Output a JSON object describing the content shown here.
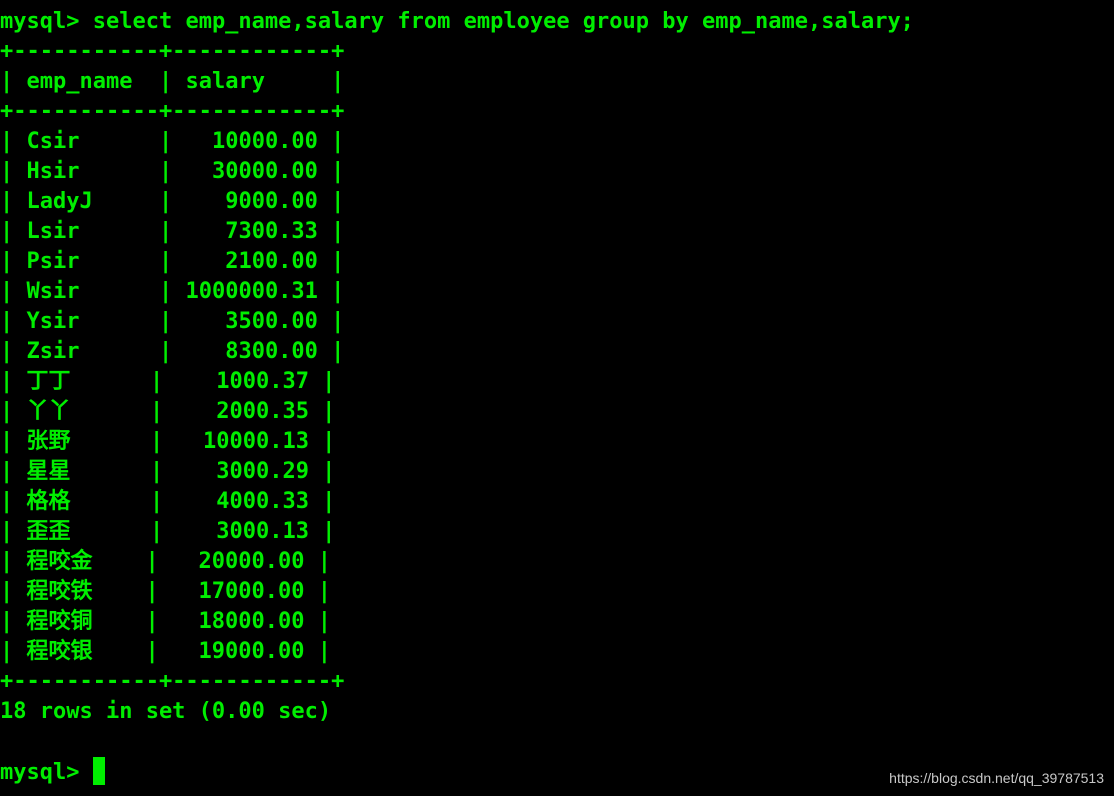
{
  "prompt": "mysql>",
  "command": "select emp_name,salary from employee group by emp_name,salary;",
  "table": {
    "border_line": "+-----------+------------+",
    "columns": [
      "emp_name",
      "salary"
    ],
    "rows": [
      [
        "Csir",
        "10000.00"
      ],
      [
        "Hsir",
        "30000.00"
      ],
      [
        "LadyJ",
        "9000.00"
      ],
      [
        "Lsir",
        "7300.33"
      ],
      [
        "Psir",
        "2100.00"
      ],
      [
        "Wsir",
        "1000000.31"
      ],
      [
        "Ysir",
        "3500.00"
      ],
      [
        "Zsir",
        "8300.00"
      ],
      [
        "丁丁",
        "1000.37"
      ],
      [
        "丫丫",
        "2000.35"
      ],
      [
        "张野",
        "10000.13"
      ],
      [
        "星星",
        "3000.29"
      ],
      [
        "格格",
        "4000.33"
      ],
      [
        "歪歪",
        "3000.13"
      ],
      [
        "程咬金",
        "20000.00"
      ],
      [
        "程咬铁",
        "17000.00"
      ],
      [
        "程咬铜",
        "18000.00"
      ],
      [
        "程咬银",
        "19000.00"
      ]
    ]
  },
  "result_summary": "18 rows in set (0.00 sec)",
  "watermark": "https://blog.csdn.net/qq_39787513",
  "colors": {
    "background": "#000000",
    "text": "#00ee00",
    "watermark": "#c8c8c8"
  }
}
